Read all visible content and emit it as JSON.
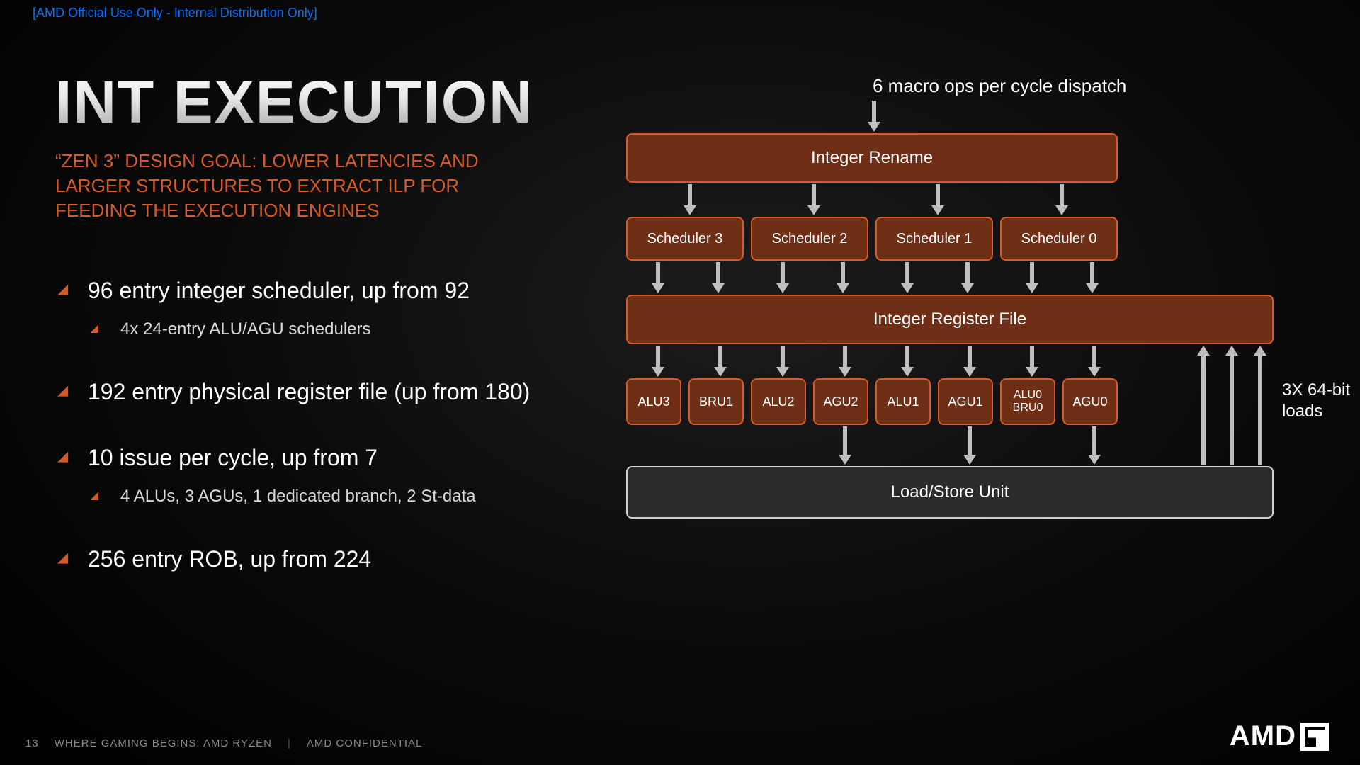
{
  "classification": "[AMD Official Use Only - Internal Distribution Only]",
  "title": "INT EXECUTION",
  "subtitle": "“ZEN 3” DESIGN GOAL: LOWER LATENCIES AND LARGER STRUCTURES TO EXTRACT ILP FOR FEEDING THE EXECUTION ENGINES",
  "bullets": [
    {
      "text": "96 entry integer scheduler, up from 92",
      "sub": [
        "4x 24-entry ALU/AGU schedulers"
      ]
    },
    {
      "text": "192 entry physical register file (up from 180)",
      "sub": []
    },
    {
      "text": "10 issue per cycle, up from 7",
      "sub": [
        "4 ALUs, 3 AGUs, 1 dedicated branch, 2 St-data"
      ]
    },
    {
      "text": "256 entry ROB, up from 224",
      "sub": []
    }
  ],
  "diagram": {
    "dispatch": "6 macro ops per cycle dispatch",
    "rename": "Integer Rename",
    "schedulers": [
      "Scheduler 3",
      "Scheduler 2",
      "Scheduler 1",
      "Scheduler 0"
    ],
    "regfile": "Integer Register File",
    "units": [
      "ALU3",
      "BRU1",
      "ALU2",
      "AGU2",
      "ALU1",
      "AGU1",
      "ALU0\nBRU0",
      "AGU0"
    ],
    "lsu": "Load/Store Unit",
    "loads_label": "3X 64-bit loads"
  },
  "footer": {
    "page": "13",
    "line1": "WHERE GAMING BEGINS:  AMD RYZEN",
    "line2": "AMD CONFIDENTIAL"
  },
  "logo": "AMD"
}
